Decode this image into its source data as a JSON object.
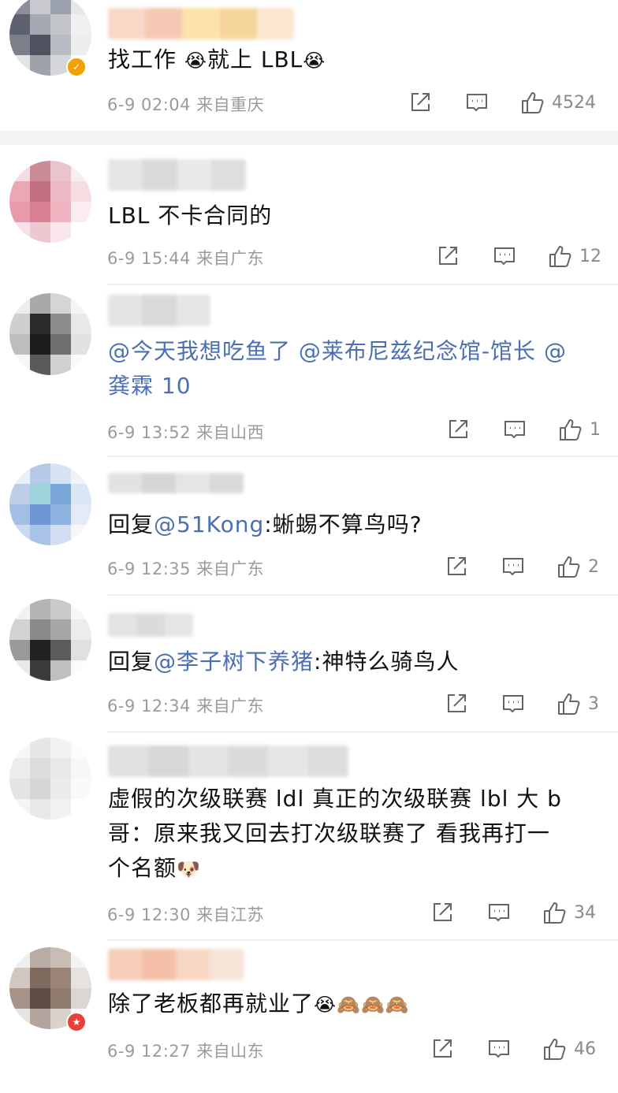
{
  "comments": [
    {
      "text": "找工作",
      "text2": "就上 LBL",
      "emoji": "😭",
      "date": "6-9 02:04",
      "location": "来自重庆",
      "likes": "4524",
      "verified": true
    },
    {
      "text": "LBL 不卡合同的",
      "date": "6-9 15:44",
      "location": "来自广东",
      "likes": "12"
    },
    {
      "mention1": "@今天我想吃鱼了",
      "mention2": "@莱布尼兹纪念馆-馆长",
      "mention3a": "@",
      "mention3b": "龚霖 10",
      "date": "6-9 13:52",
      "location": "来自山西",
      "likes": "1"
    },
    {
      "prefix": "回复",
      "mention": "@51Kong",
      "text": ":蜥蜴不算鸟吗?",
      "date": "6-9 12:35",
      "location": "来自广东",
      "likes": "2"
    },
    {
      "prefix": "回复",
      "mention": "@李子树下养猪",
      "text": ":神特么骑鸟人",
      "date": "6-9 12:34",
      "location": "来自广东",
      "likes": "3"
    },
    {
      "line1": "虚假的次级联赛 ldl 真正的次级联赛 lbl 大 b",
      "line2": "哥：原来我又回去打次级联赛了 看我再打一",
      "line3": "个名额",
      "emoji": "🐶",
      "date": "6-9 12:30",
      "location": "来自江苏",
      "likes": "34"
    },
    {
      "text": "除了老板都再就业了",
      "emoji1": "😭",
      "emoji2": "🙈",
      "date": "6-9 12:27",
      "location": "来自山东",
      "likes": "46"
    }
  ]
}
